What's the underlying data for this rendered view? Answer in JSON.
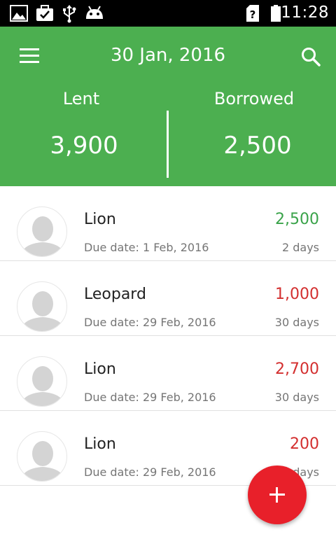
{
  "status_bar": {
    "time": "11:28",
    "icons": [
      "image-icon",
      "briefcase-check-icon",
      "usb-icon",
      "android-icon",
      "no-sim-icon",
      "battery-icon"
    ]
  },
  "header": {
    "date": "30 Jan, 2016",
    "lent_label": "Lent",
    "lent_value": "3,900",
    "borrowed_label": "Borrowed",
    "borrowed_value": "2,500",
    "background_color": "#4caf50"
  },
  "entries": [
    {
      "name": "Lion",
      "due": "Due date: 1 Feb, 2016",
      "amount": "2,500",
      "days": "2 days",
      "amount_color": "#3aa34a"
    },
    {
      "name": "Leopard",
      "due": "Due date: 29 Feb, 2016",
      "amount": "1,000",
      "days": "30 days",
      "amount_color": "#d32f2f"
    },
    {
      "name": "Lion",
      "due": "Due date: 29 Feb, 2016",
      "amount": "2,700",
      "days": "30 days",
      "amount_color": "#d32f2f"
    },
    {
      "name": "Lion",
      "due": "Due date: 29 Feb, 2016",
      "amount": "200",
      "days": "30 days",
      "amount_color": "#d32f2f"
    }
  ],
  "fab": {
    "icon": "plus-icon",
    "color": "#e8202a"
  }
}
